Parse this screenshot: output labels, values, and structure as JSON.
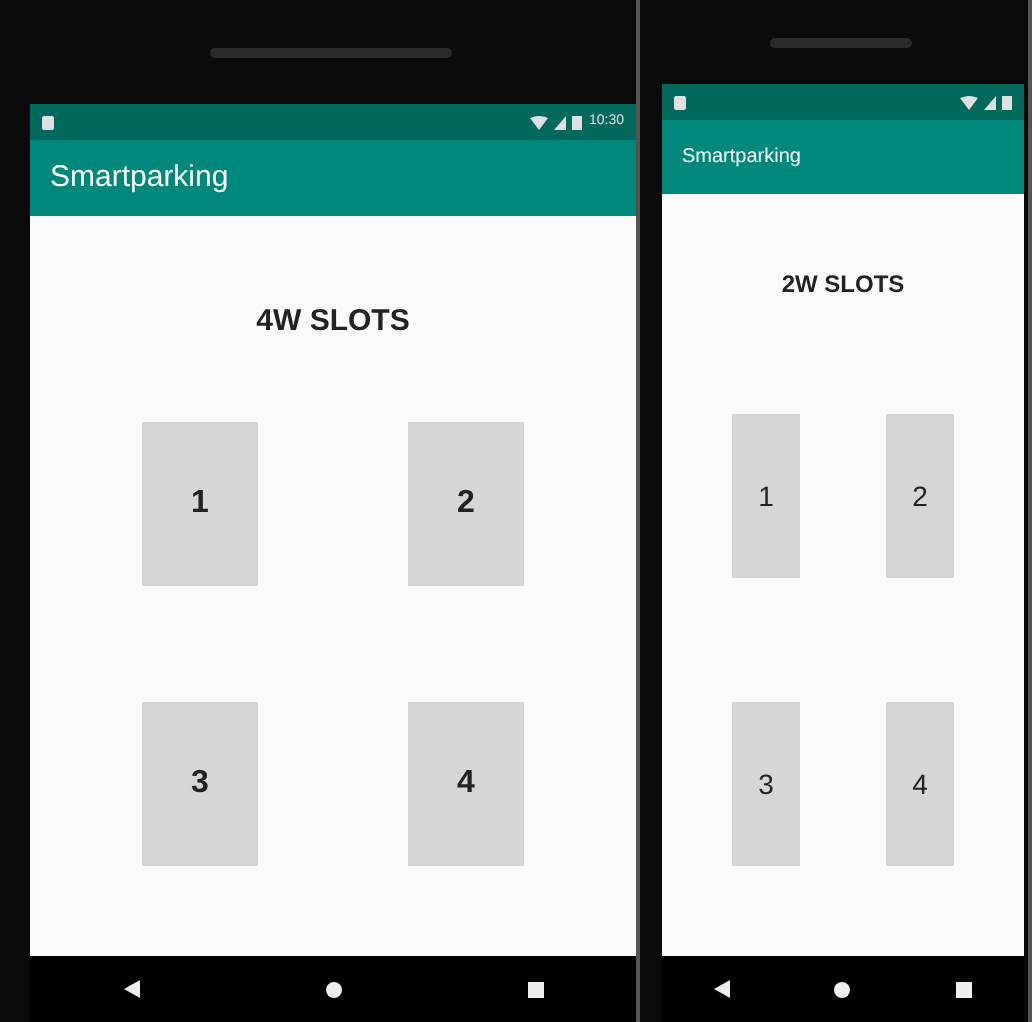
{
  "phones": [
    {
      "status_time": "10:30",
      "app_title": "Smartparking",
      "heading": "4W SLOTS",
      "slots": [
        "1",
        "2",
        "3",
        "4"
      ]
    },
    {
      "app_title": "Smartparking",
      "heading": "2W SLOTS",
      "slots": [
        "1",
        "2",
        "3",
        "4"
      ]
    }
  ]
}
